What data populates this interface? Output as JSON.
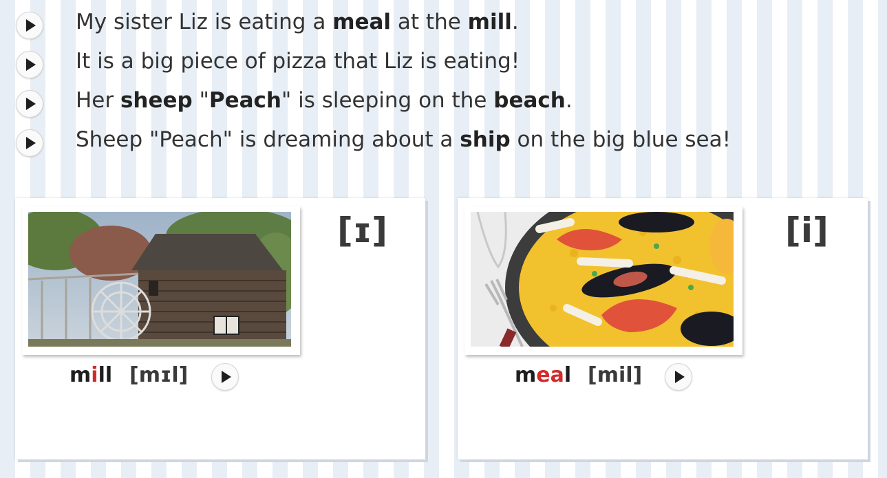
{
  "sentences": [
    {
      "parts": [
        "My sister Liz is eating a ",
        "meal",
        " at the ",
        "mill",
        "."
      ]
    },
    {
      "parts": [
        "It is a big piece of pizza that Liz is eating!"
      ]
    },
    {
      "parts": [
        "Her ",
        "sheep",
        " \"",
        "Peach",
        "\" is sleeping on the ",
        "beach",
        "."
      ]
    },
    {
      "parts": [
        "Sheep \"Peach\" is dreaming about a ",
        "ship",
        " on the big blue sea!"
      ]
    }
  ],
  "cards": [
    {
      "symbol": "[ɪ]",
      "word_pre": "m",
      "word_hl": "i",
      "word_post": "ll",
      "ipa": "[mɪl]",
      "image": "water-mill-photo"
    },
    {
      "symbol": "[i]",
      "word_pre": "m",
      "word_hl": "ea",
      "word_post": "l",
      "ipa": "[mil]",
      "image": "paella-dish-photo"
    }
  ],
  "colors": {
    "highlight": "#d22b2b",
    "stripe": "#e8eef5"
  },
  "icons": {
    "play": "play-icon"
  }
}
